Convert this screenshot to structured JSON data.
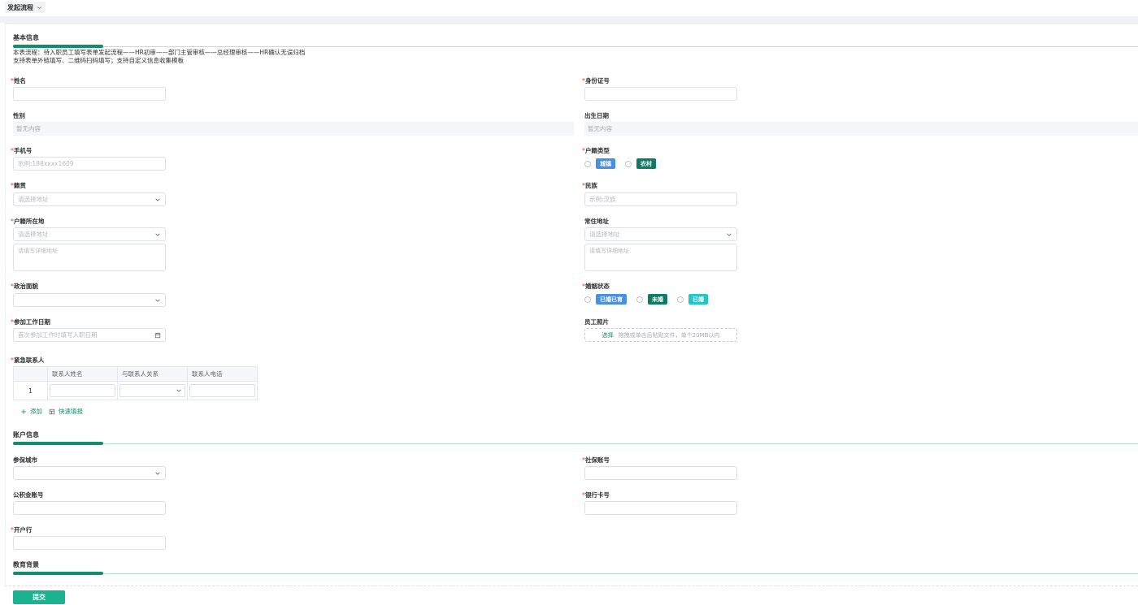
{
  "header": {
    "flow_menu_label": "发起流程"
  },
  "sections": {
    "basic": "基本信息",
    "account": "账户信息",
    "education": "教育背景"
  },
  "notes": {
    "line1": "本表流程：待入职员工填写表单发起流程——HR初审——部门主管审核——总经理审核——HR确认无误归档",
    "line2": "支持表单外链填写、二维码扫码填写；支持自定义信息收集模板"
  },
  "fields": {
    "name": {
      "label": "姓名",
      "required": "*",
      "value": ""
    },
    "id_number": {
      "label": "身份证号",
      "required": "*",
      "value": ""
    },
    "gender": {
      "label": "性别",
      "value": "暂无内容"
    },
    "birth_date": {
      "label": "出生日期",
      "value": "暂无内容"
    },
    "phone": {
      "label": "手机号",
      "required": "*",
      "placeholder": "示例:188xxxx1609"
    },
    "household_type": {
      "label": "户籍类型",
      "required": "*",
      "options": [
        "城镇",
        "农村"
      ],
      "option_colors": [
        "#4a90e2",
        "#0f7a66"
      ]
    },
    "native_place": {
      "label": "籍贯",
      "required": "*",
      "placeholder": "请选择地址"
    },
    "ethnicity": {
      "label": "民族",
      "required": "*",
      "placeholder": "示例:汉族"
    },
    "household_location": {
      "label": "户籍所在地",
      "required": "*",
      "select_placeholder": "请选择地址",
      "detail_placeholder": "请填写详细地址"
    },
    "residence": {
      "label": "常住地址",
      "select_placeholder": "请选择地址",
      "detail_placeholder": "请填写详细地址"
    },
    "political_status": {
      "label": "政治面貌",
      "required": "*",
      "value": ""
    },
    "marital_status": {
      "label": "婚姻状态",
      "required": "*",
      "options": [
        "已婚已育",
        "未婚",
        "已婚"
      ],
      "option_colors": [
        "#4a90e2",
        "#0f7a66",
        "#26c6c6"
      ]
    },
    "work_start_date": {
      "label": "参加工作日期",
      "required": "*",
      "placeholder": "首次参加工作时填写入职日期"
    },
    "employee_photo": {
      "label": "员工照片",
      "select_text": "选择",
      "hint": "拖拽或单击后粘贴文件，单个20MB以内"
    },
    "emergency_contact": {
      "label": "紧急联系人",
      "required": "*"
    },
    "insurance_city": {
      "label": "参保城市",
      "value": ""
    },
    "social_security_no": {
      "label": "社保账号",
      "required": "*",
      "value": ""
    },
    "housing_fund_no": {
      "label": "公积金账号",
      "value": ""
    },
    "bank_card_no": {
      "label": "银行卡号",
      "required": "*",
      "value": ""
    },
    "bank_branch": {
      "label": "开户行",
      "required": "*",
      "value": ""
    }
  },
  "contact_table": {
    "columns": [
      "",
      "联系人姓名",
      "与联系人关系",
      "联系人电话"
    ],
    "rows": [
      {
        "index": "1"
      }
    ]
  },
  "actions": {
    "add": "添加",
    "quick_fill": "快速填报",
    "submit": "提交"
  },
  "colors": {
    "accent": "#138d6f",
    "submit": "#1bb28f",
    "required": "#f56c6c"
  }
}
